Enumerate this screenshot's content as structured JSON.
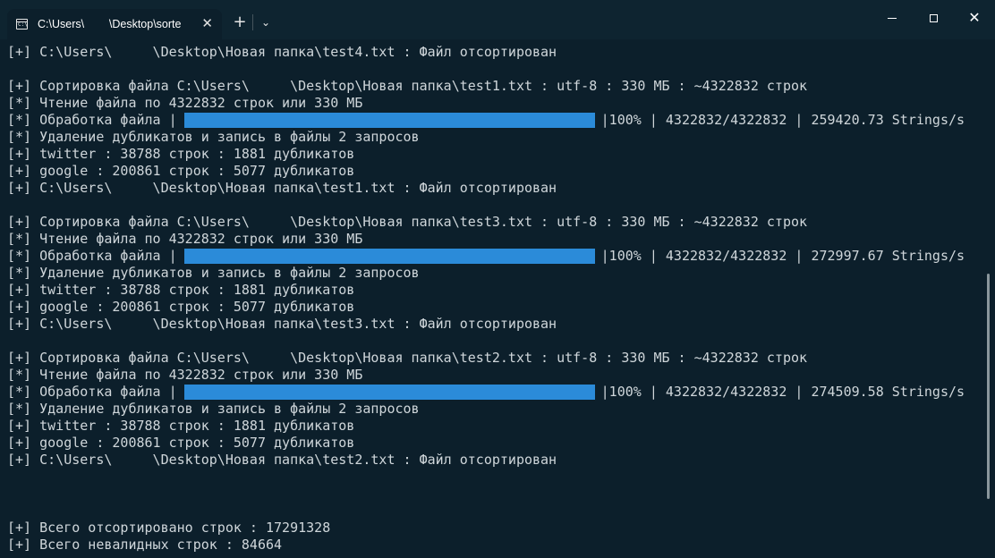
{
  "titlebar": {
    "tab_title": "C:\\Users\\        \\Desktop\\sorte",
    "tab_icon_text": "C:\\",
    "tab_close": "✕",
    "new_tab_label": "+",
    "dropdown_label": "⌄",
    "close_label": "✕"
  },
  "terminal": {
    "line1": "[+] C:\\Users\\     \\Desktop\\Новая папка\\test4.txt : Файл отсортирован",
    "blockA": {
      "l1": "[+] Сортировка файла C:\\Users\\     \\Desktop\\Новая папка\\test1.txt : utf-8 : 330 МБ : ~4322832 строк",
      "l2": "[*] Чтение файла по 4322832 строк или 330 МБ",
      "l3_prefix": "[*] Обработка файла |",
      "l3_suffix": "|100% | 4322832/4322832 | 259420.73 Strings/s",
      "progress": 100,
      "l4": "[*] Удаление дубликатов и запись в файлы 2 запросов",
      "l5": "[+] twitter : 38788 строк : 1881 дубликатов",
      "l6": "[+] google : 200861 строк : 5077 дубликатов",
      "l7": "[+] C:\\Users\\     \\Desktop\\Новая папка\\test1.txt : Файл отсортирован"
    },
    "blockB": {
      "l1": "[+] Сортировка файла C:\\Users\\     \\Desktop\\Новая папка\\test3.txt : utf-8 : 330 МБ : ~4322832 строк",
      "l2": "[*] Чтение файла по 4322832 строк или 330 МБ",
      "l3_prefix": "[*] Обработка файла |",
      "l3_suffix": "|100% | 4322832/4322832 | 272997.67 Strings/s",
      "progress": 100,
      "l4": "[*] Удаление дубликатов и запись в файлы 2 запросов",
      "l5": "[+] twitter : 38788 строк : 1881 дубликатов",
      "l6": "[+] google : 200861 строк : 5077 дубликатов",
      "l7": "[+] C:\\Users\\     \\Desktop\\Новая папка\\test3.txt : Файл отсортирован"
    },
    "blockC": {
      "l1": "[+] Сортировка файла C:\\Users\\     \\Desktop\\Новая папка\\test2.txt : utf-8 : 330 МБ : ~4322832 строк",
      "l2": "[*] Чтение файла по 4322832 строк или 330 МБ",
      "l3_prefix": "[*] Обработка файла |",
      "l3_suffix": "|100% | 4322832/4322832 | 274509.58 Strings/s",
      "progress": 100,
      "l4": "[*] Удаление дубликатов и запись в файлы 2 запросов",
      "l5": "[+] twitter : 38788 строк : 1881 дубликатов",
      "l6": "[+] google : 200861 строк : 5077 дубликатов",
      "l7": "[+] C:\\Users\\     \\Desktop\\Новая папка\\test2.txt : Файл отсортирован"
    },
    "total_sorted": "[+] Всего отсортировано строк : 17291328",
    "total_invalid": "[+] Всего невалидных строк : 84664"
  },
  "colors": {
    "background": "#0c1f2b",
    "titlebar": "#0e2430",
    "progress": "#2b8bd9",
    "text": "#cfd6da"
  }
}
